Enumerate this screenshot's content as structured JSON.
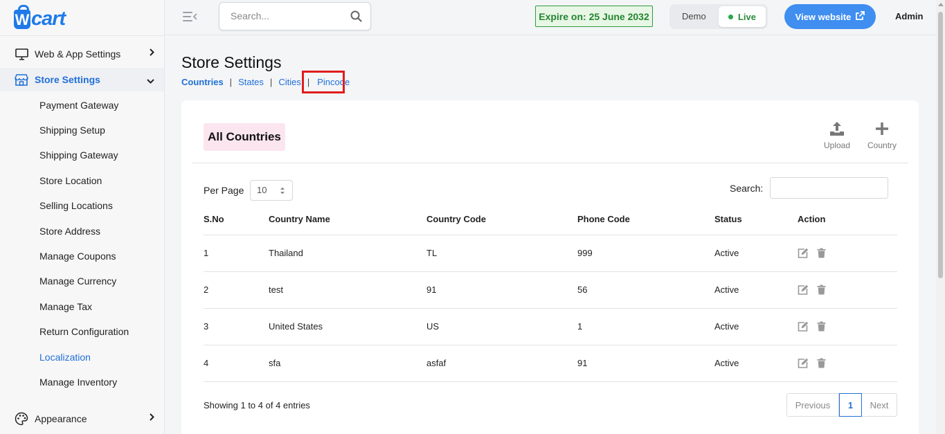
{
  "brand": {
    "logo_letter": "W",
    "logo_text": "cart"
  },
  "colors": {
    "accent": "#1f6fd6",
    "live_green": "#2aa74a",
    "highlight": "#e01c1c",
    "title_badge_bg": "#fbe5ee"
  },
  "sidebar": {
    "groups": [
      {
        "label": "Web & App Settings",
        "icon": "monitor-icon",
        "chevron": "›"
      },
      {
        "label": "Store Settings",
        "icon": "store-icon",
        "chevron": "⌄"
      },
      {
        "label": "Appearance",
        "icon": "palette-icon",
        "chevron": "›"
      }
    ],
    "store_items": [
      "Payment Gateway",
      "Shipping Setup",
      "Shipping Gateway",
      "Store Location",
      "Selling Locations",
      "Store Address",
      "Manage Coupons",
      "Manage Currency",
      "Manage Tax",
      "Return Configuration",
      "Localization",
      "Manage Inventory"
    ],
    "active_item": "Localization"
  },
  "header": {
    "search_placeholder": "Search...",
    "expire_text": "Expire on: 25 June 2032",
    "mode_demo": "Demo",
    "mode_live": "Live",
    "view_website": "View website",
    "user": "Admin"
  },
  "page": {
    "title": "Store Settings",
    "tabs": [
      "Countries",
      "States",
      "Cities",
      "Pincode"
    ],
    "active_tab": "Countries",
    "tab_separator": "|"
  },
  "card": {
    "title": "All Countries",
    "actions": {
      "upload": "Upload",
      "add": "Country"
    },
    "per_page_label": "Per Page",
    "per_page_value": "10",
    "search_label": "Search:",
    "columns": [
      "S.No",
      "Country Name",
      "Country Code",
      "Phone Code",
      "Status",
      "Action"
    ],
    "rows": [
      [
        "1",
        "Thailand",
        "TL",
        "999",
        "Active"
      ],
      [
        "2",
        "test",
        "91",
        "56",
        "Active"
      ],
      [
        "3",
        "United States",
        "US",
        "1",
        "Active"
      ],
      [
        "4",
        "sfa",
        "asfaf",
        "91",
        "Active"
      ]
    ],
    "showing": "Showing 1 to 4 of 4 entries",
    "pager": {
      "prev": "Previous",
      "current": "1",
      "next": "Next"
    }
  }
}
